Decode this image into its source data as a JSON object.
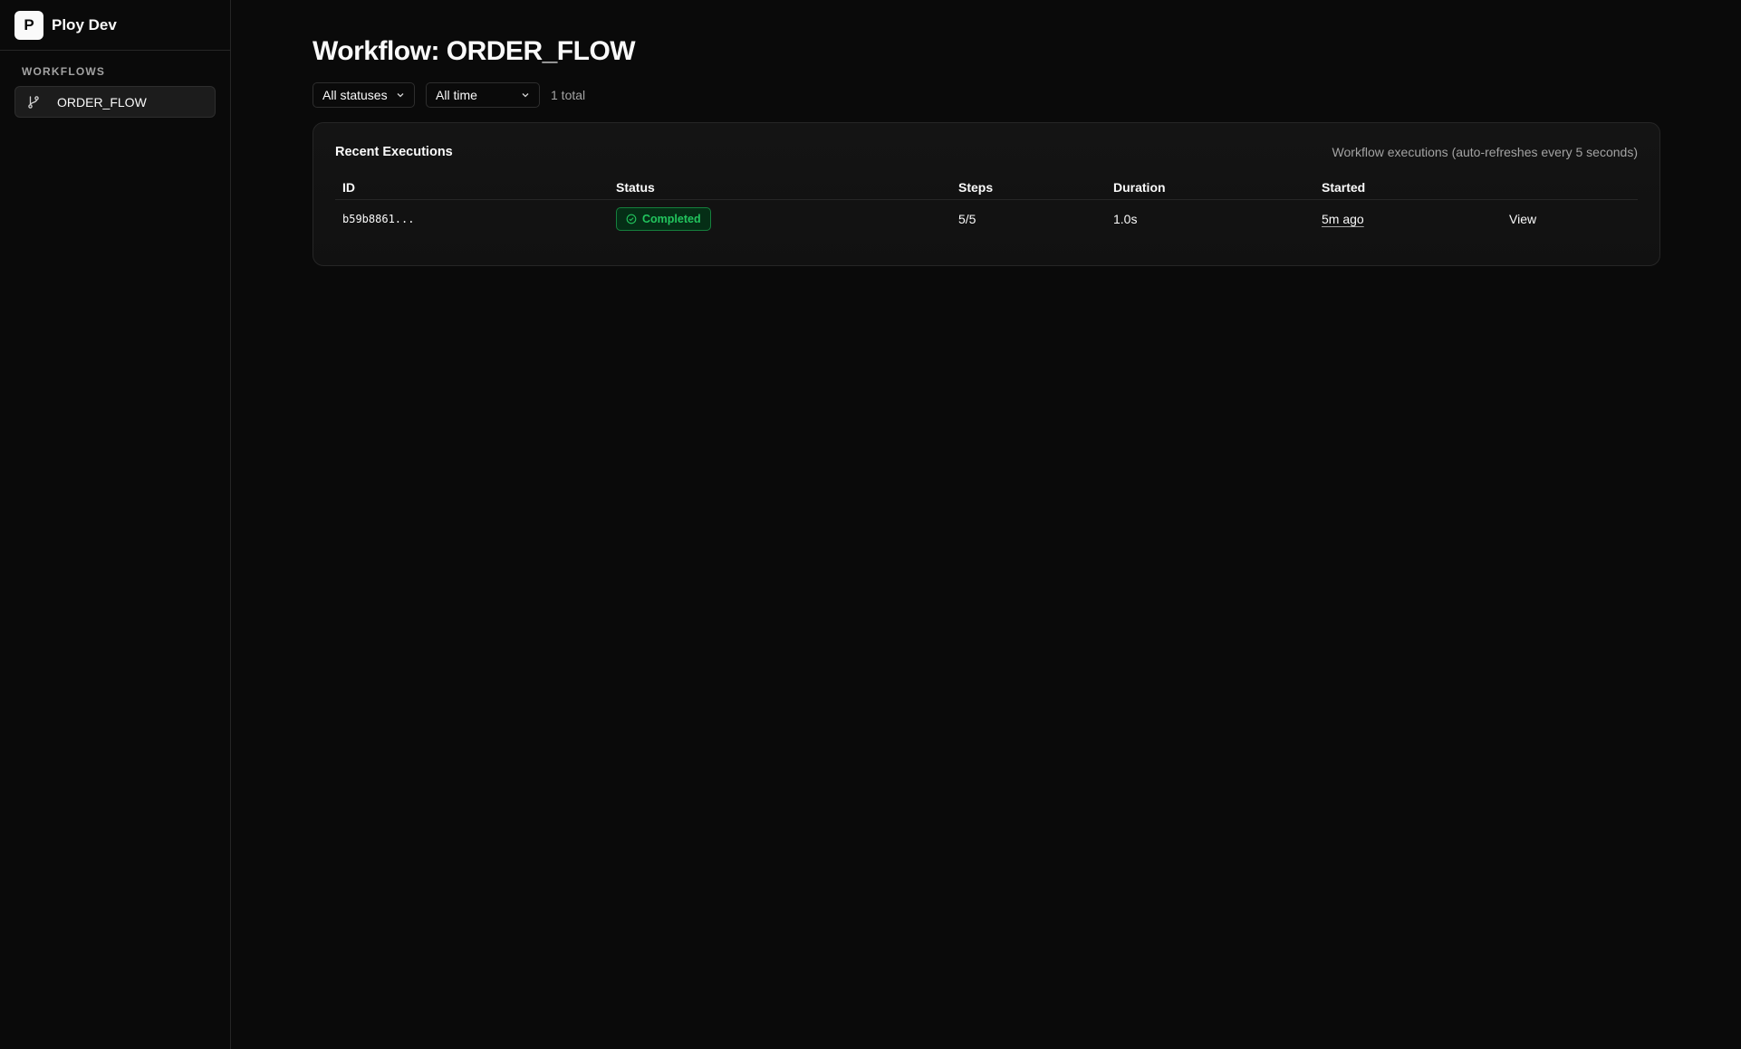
{
  "app": {
    "logo_letter": "P",
    "name": "Ploy Dev"
  },
  "sidebar": {
    "section_label": "WORKFLOWS",
    "items": [
      {
        "label": "ORDER_FLOW",
        "icon": "git-branch-icon",
        "active": true
      }
    ]
  },
  "main": {
    "title": "Workflow: ORDER_FLOW",
    "filters": {
      "status": {
        "selected": "All statuses"
      },
      "time": {
        "selected": "All time"
      }
    },
    "total": "1 total"
  },
  "card": {
    "title": "Recent Executions",
    "description": "Workflow executions (auto-refreshes every 5 seconds)",
    "columns": [
      "ID",
      "Status",
      "Steps",
      "Duration",
      "Started"
    ],
    "rows": [
      {
        "id": "b59b8861...",
        "status": "Completed",
        "steps": "5/5",
        "duration": "1.0s",
        "started": "5m ago",
        "action": "View"
      }
    ]
  },
  "colors": {
    "background": "#0a0a0a",
    "border": "#262626",
    "success": "#22c55e",
    "success_bg": "#052e16"
  }
}
